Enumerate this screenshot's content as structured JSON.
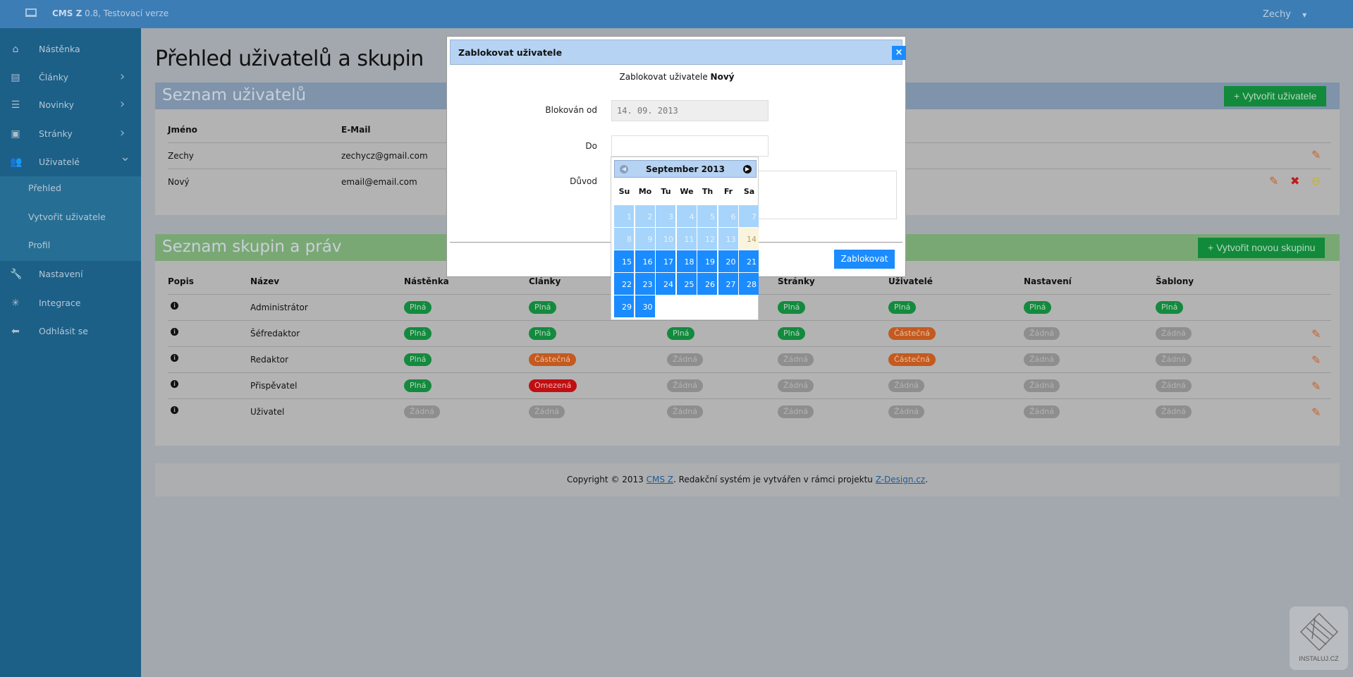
{
  "topbar": {
    "brand_bold": "CMS Z",
    "brand_rest": " 0.8, Testovací verze",
    "user": "Zechy",
    "icons": {
      "monitor": "monitor-icon",
      "caret": "caret-down-icon"
    }
  },
  "sidebar": {
    "items": [
      {
        "label": "Nástěnka",
        "icon": "home-icon",
        "glyph": "⌂"
      },
      {
        "label": "Články",
        "icon": "articles-icon",
        "glyph": "▤",
        "chevron": "›"
      },
      {
        "label": "Novinky",
        "icon": "list-icon",
        "glyph": "☰",
        "chevron": "›"
      },
      {
        "label": "Stránky",
        "icon": "page-icon",
        "glyph": "▣",
        "chevron": "›"
      },
      {
        "label": "Uživatelé",
        "icon": "users-icon",
        "glyph": "👥",
        "chevron": "⌄"
      },
      {
        "label": "Nastavení",
        "icon": "wrench-icon",
        "glyph": "🔧"
      },
      {
        "label": "Integrace",
        "icon": "magic-icon",
        "glyph": "✳"
      },
      {
        "label": "Odhlásit se",
        "icon": "arrow-left-icon",
        "glyph": "⬅"
      }
    ],
    "subitems": [
      "Přehled",
      "Vytvořit uživatele",
      "Profil"
    ]
  },
  "page_title": "Přehled uživatelů a skupin",
  "users": {
    "title": "Seznam uživatelů",
    "create_button": "+  Vytvořit uživatele",
    "headers": [
      "Jméno",
      "E-Mail"
    ],
    "rows": [
      {
        "name": "Zechy",
        "email": "zechycz@gmail.com",
        "actions": [
          "edit"
        ]
      },
      {
        "name": "Nový",
        "email": "email@email.com",
        "actions": [
          "edit",
          "delete",
          "block"
        ]
      }
    ]
  },
  "groups": {
    "title": "Seznam skupin a práv",
    "create_button": "+  Vytvořit novou skupinu",
    "headers": [
      "Popis",
      "Název",
      "Nástěnka",
      "Články",
      "",
      "Stránky",
      "Uživatelé",
      "Nastavení",
      "Šablony"
    ],
    "rows": [
      {
        "name": "Administrátor",
        "perms": [
          "Plná",
          "Plná",
          null,
          "Plná",
          "Plná",
          "Plná",
          "Plná"
        ],
        "edit": false
      },
      {
        "name": "Šéfredaktor",
        "perms": [
          "Plná",
          "Plná",
          "Plná",
          "Plná",
          "Částečná",
          "Žádná",
          "Žádná"
        ],
        "edit": true
      },
      {
        "name": "Redaktor",
        "perms": [
          "Plná",
          "Částečná",
          "Žádná",
          "Žádná",
          "Částečná",
          "Žádná",
          "Žádná"
        ],
        "edit": true
      },
      {
        "name": "Přispěvatel",
        "perms": [
          "Plná",
          "Omezená",
          "Žádná",
          "Žádná",
          "Žádná",
          "Žádná",
          "Žádná"
        ],
        "edit": true
      },
      {
        "name": "Uživatel",
        "perms": [
          "Žádná",
          "Žádná",
          "Žádná",
          "Žádná",
          "Žádná",
          "Žádná",
          "Žádná"
        ],
        "edit": true
      }
    ]
  },
  "footer": {
    "pre": "Copyright © 2013 ",
    "link1": "CMS Z",
    "mid": ". Redakční systém je vytvářen v rámci projektu ",
    "link2": "Z-Design.cz",
    "post": "."
  },
  "modal": {
    "title": "Zablokovat uživatele",
    "intro": "Zablokovat uživatele ",
    "intro_user": "Nový",
    "from_label": "Blokován od",
    "from_value": "14. 09. 2013",
    "to_label": "Do",
    "to_value": "",
    "reason_label": "Důvod",
    "reason_value": "",
    "submit": "Zablokovat",
    "close": "×"
  },
  "calendar": {
    "month": "September 2013",
    "dow": [
      "Su",
      "Mo",
      "Tu",
      "We",
      "Th",
      "Fr",
      "Sa"
    ],
    "first_weekday": 0,
    "days_in_month": 30,
    "today": 14,
    "colors": {
      "active": "#1a8cff",
      "past": "#a6d4fa",
      "today": "#fbf4dd"
    }
  },
  "watermark": "INSTALUJ.CZ",
  "colors": {
    "topbar": "#3d7db5",
    "sidebar": "#1c5f87",
    "users_header": "#7f93aa",
    "groups_header": "#7aa874",
    "button_green": "#128a3b",
    "badge_full": "#138a3e",
    "badge_partial": "#c45a1f",
    "badge_limited": "#c00f12",
    "badge_none": "#8e8e8e"
  }
}
